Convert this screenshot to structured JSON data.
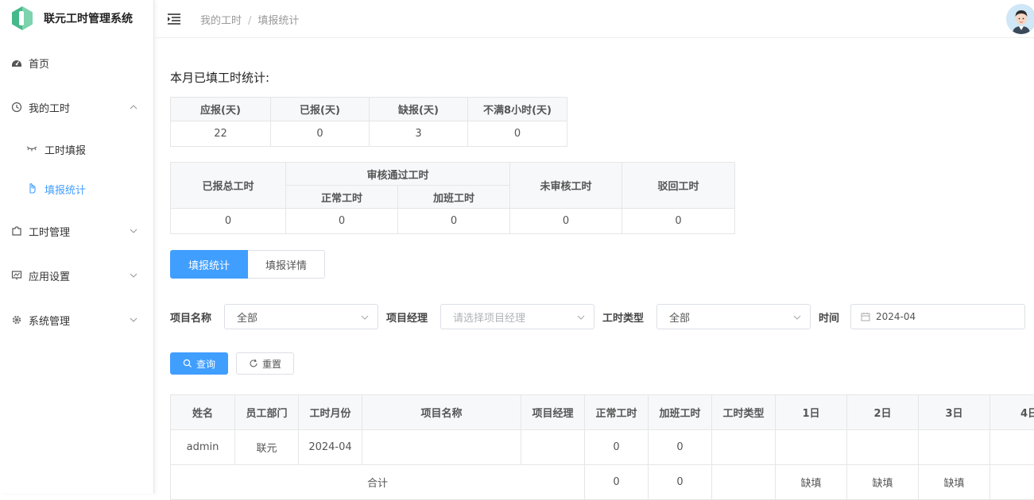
{
  "app": {
    "title": "联元工时管理系统"
  },
  "sidebar": {
    "items": [
      {
        "label": "首页",
        "icon": "dashboard-icon"
      },
      {
        "label": "我的工时",
        "icon": "clock-icon",
        "expanded": true,
        "children": [
          {
            "label": "工时填报",
            "icon": "eye-closed-icon"
          },
          {
            "label": "填报统计",
            "icon": "hand-icon",
            "active": true
          }
        ]
      },
      {
        "label": "工时管理",
        "icon": "puzzle-icon"
      },
      {
        "label": "应用设置",
        "icon": "monitor-icon"
      },
      {
        "label": "系统管理",
        "icon": "gear-icon"
      }
    ]
  },
  "header": {
    "breadcrumb": [
      "我的工时",
      "填报统计"
    ]
  },
  "stats": {
    "title": "本月已填工时统计:",
    "table1": {
      "headers": [
        "应报(天)",
        "已报(天)",
        "缺报(天)",
        "不满8小时(天)"
      ],
      "values": [
        "22",
        "0",
        "3",
        "0"
      ]
    },
    "table2": {
      "headers": {
        "total": "已报总工时",
        "approved_group": "审核通过工时",
        "normal": "正常工时",
        "overtime": "加班工时",
        "pending": "未审核工时",
        "rejected": "驳回工时"
      },
      "values": [
        "0",
        "0",
        "0",
        "0",
        "0"
      ]
    }
  },
  "tabs": [
    "填报统计",
    "填报详情"
  ],
  "filters": {
    "project_name": {
      "label": "项目名称",
      "value": "全部"
    },
    "project_manager": {
      "label": "项目经理",
      "placeholder": "请选择项目经理"
    },
    "hour_type": {
      "label": "工时类型",
      "value": "全部"
    },
    "time": {
      "label": "时间",
      "value": "2024-04"
    }
  },
  "buttons": {
    "query": "查询",
    "reset": "重置"
  },
  "table": {
    "headers": [
      "姓名",
      "员工部门",
      "工时月份",
      "项目名称",
      "项目经理",
      "正常工时",
      "加班工时",
      "工时类型",
      "1日",
      "2日",
      "3日",
      "4日"
    ],
    "rows": [
      {
        "name": "admin",
        "dept": "联元",
        "month": "2024-04",
        "project": "",
        "manager": "",
        "normal": "0",
        "overtime": "0",
        "type": "",
        "d1": "",
        "d2": "",
        "d3": "",
        "d4": ""
      }
    ],
    "total": {
      "label": "合计",
      "normal": "0",
      "overtime": "0",
      "d1": "缺填",
      "d2": "缺填",
      "d3": "缺填",
      "d4": ""
    }
  },
  "colors": {
    "primary": "#409eff",
    "missing": "#d0342c",
    "warning": "#e6a23c"
  }
}
